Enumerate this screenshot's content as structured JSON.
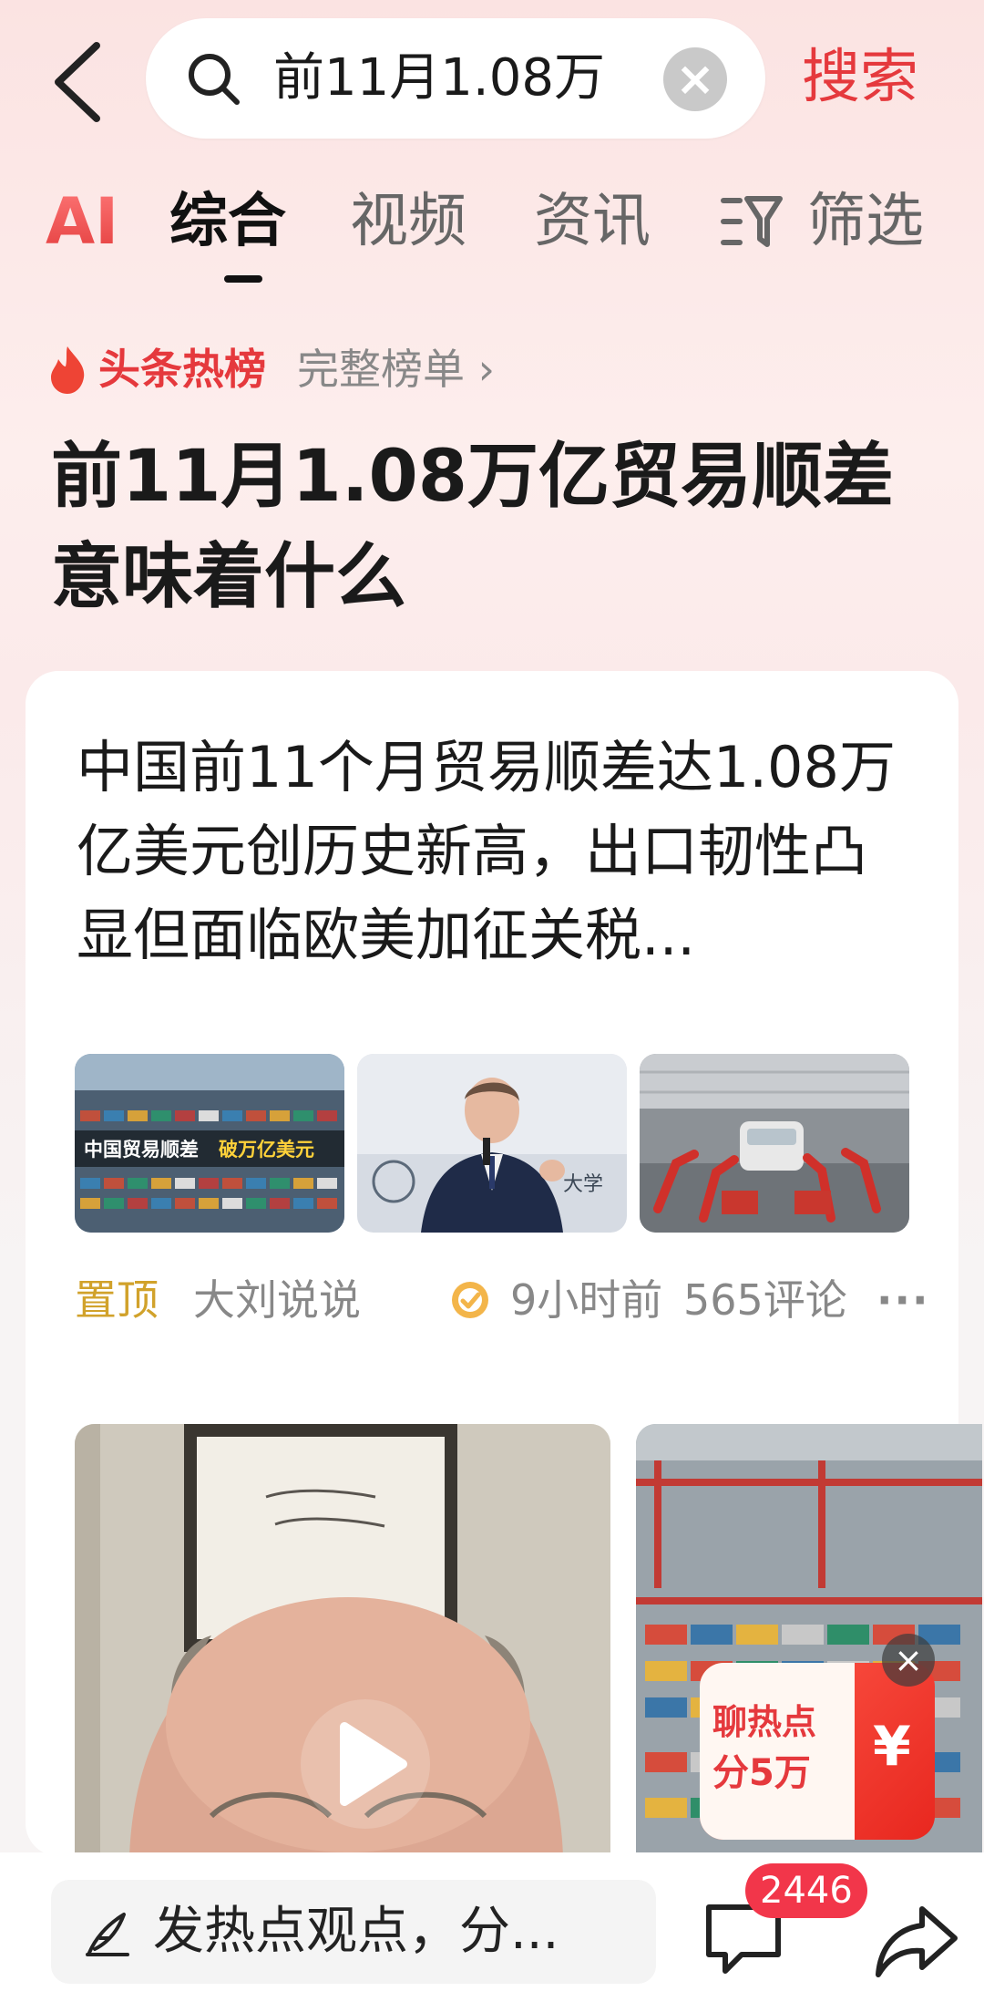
{
  "search": {
    "query": "前11月1.08万",
    "search_button": "搜索"
  },
  "tabs": {
    "ai": "AI",
    "items": [
      {
        "label": "综合",
        "active": true
      },
      {
        "label": "视频",
        "active": false
      },
      {
        "label": "资讯",
        "active": false
      }
    ],
    "filter": "筛选"
  },
  "hot_list": {
    "title": "头条热榜",
    "full_list": "完整榜单 ›",
    "headline": "前11月1.08万亿贸易顺差意味着什么"
  },
  "article": {
    "text": "中国前11个月贸易顺差达1.08万亿美元创历史新高，出口韧性凸显但面临欧美加征关税...",
    "thumb1_caption": "中国贸易顺差",
    "thumb1_caption_highlight": "破万亿美元",
    "thumb2_caption": "大学",
    "pinned": "置顶",
    "author": "大刘说说",
    "time": "9小时前",
    "comments": "565评论",
    "more": "···"
  },
  "promo": {
    "line1": "聊热点",
    "line2": "分5万",
    "symbol": "¥",
    "close": "×"
  },
  "bottom": {
    "comment_placeholder": "发热点观点，分...",
    "comment_count": "2446"
  },
  "colors": {
    "accent": "#e5393d",
    "pinned": "#d1a22b",
    "badge": "#f2364a"
  },
  "icons": [
    "back-arrow-icon",
    "search-icon",
    "clear-icon",
    "filter-icon",
    "flame-icon",
    "verified-icon",
    "play-icon",
    "pen-icon",
    "comment-icon",
    "share-icon"
  ]
}
